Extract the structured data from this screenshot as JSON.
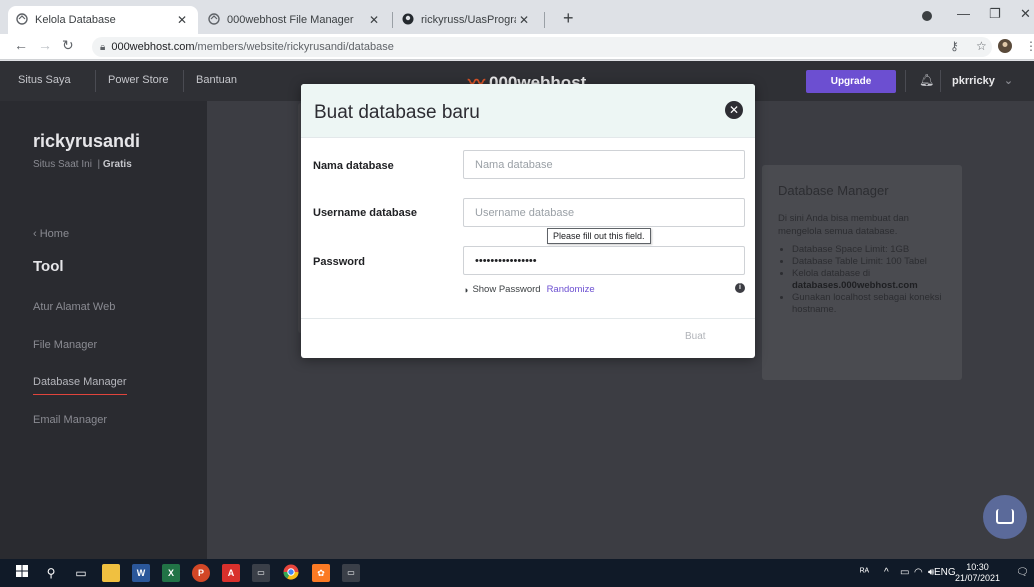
{
  "browser": {
    "tabs": [
      {
        "title": "Kelola Database",
        "icon": "globe-icon",
        "active": true
      },
      {
        "title": "000webhost File Manager",
        "icon": "globe-icon",
        "active": false
      },
      {
        "title": "rickyruss/UasProgram: Iuran Kas",
        "icon": "github-icon",
        "active": false
      }
    ],
    "new_tab": "+",
    "url_host": "000webhost.com",
    "url_path": "/members/website/rickyrusandi/database"
  },
  "topnav": {
    "links": [
      "Situs Saya",
      "Power Store",
      "Bantuan"
    ],
    "logo": "000webhost",
    "upgrade_label": "Upgrade",
    "username": "pkrricky"
  },
  "sidebar": {
    "owner": "rickyrusandi",
    "site_label": "Situs Saat Ini",
    "plan": "Gratis",
    "home": "Home",
    "section": "Tool",
    "items": [
      {
        "label": "Atur Alamat Web",
        "active": false
      },
      {
        "label": "File Manager",
        "active": false
      },
      {
        "label": "Database Manager",
        "active": true
      },
      {
        "label": "Email Manager",
        "active": false
      }
    ]
  },
  "info_card": {
    "title": "Database Manager",
    "description": "Di sini Anda bisa membuat dan mengelola semua database.",
    "bullets": [
      "Database Space Limit: 1GB",
      "Database Table Limit: 100 Tabel",
      "Kelola database di",
      "Gunakan localhost sebagai koneksi hostname."
    ],
    "bold_link": "databases.000webhost.com"
  },
  "modal": {
    "title": "Buat database baru",
    "fields": {
      "name": {
        "label": "Nama database",
        "placeholder": "Nama database",
        "value": ""
      },
      "username": {
        "label": "Username database",
        "placeholder": "Username database",
        "value": ""
      },
      "password": {
        "label": "Password",
        "value": "xxxxxxxxxxxxxxxx"
      }
    },
    "validation_tooltip": "Please fill out this field.",
    "show_password": "Show Password",
    "randomize": "Randomize",
    "submit_label": "Buat"
  },
  "taskbar": {
    "language": "ENG",
    "time": "10:30",
    "date": "21/07/2021"
  },
  "colors": {
    "accent": "#6c4fd1",
    "active_underline": "#e0443c",
    "sidebar_bg": "#2a2b30"
  }
}
